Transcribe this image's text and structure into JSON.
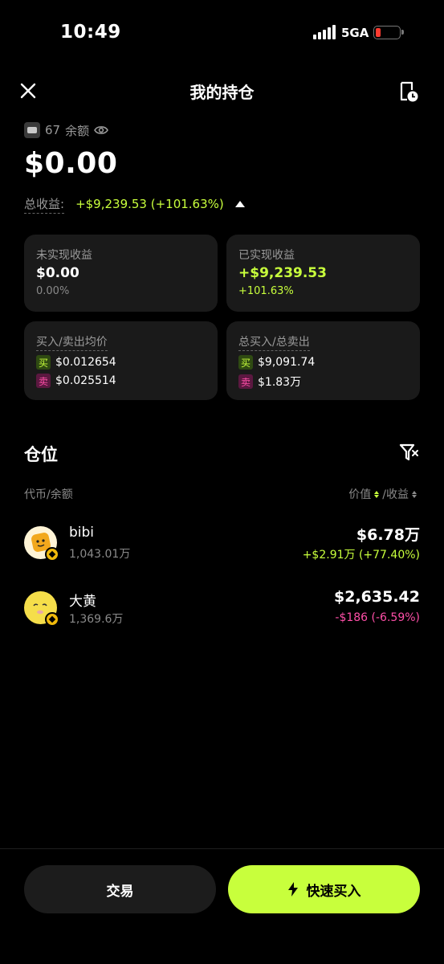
{
  "status": {
    "time": "10:49",
    "network": "5GA",
    "battery_level": 0.2,
    "battery_color": "#ff3b30"
  },
  "header": {
    "title": "我的持仓"
  },
  "balance": {
    "account_count": "67",
    "label": "余额",
    "value": "$0.00",
    "total_pnl_label": "总收益:",
    "total_pnl_value": "+$9,239.53 (+101.63%)"
  },
  "cards": {
    "unrealized": {
      "label": "未实现收益",
      "value": "$0.00",
      "percent": "0.00%"
    },
    "realized": {
      "label": "已实现收益",
      "value": "+$9,239.53",
      "percent": "+101.63%"
    },
    "avg_price": {
      "label": "买入/卖出均价",
      "buy_tag": "买",
      "buy_value": "$0.012654",
      "sell_tag": "卖",
      "sell_value": "$0.025514"
    },
    "totals": {
      "label": "总买入/总卖出",
      "buy_tag": "买",
      "buy_value": "$9,091.74",
      "sell_tag": "卖",
      "sell_value": "$1.83万"
    }
  },
  "positions": {
    "title": "仓位",
    "col_left": "代币/余额",
    "col_value": "价值",
    "col_pnl": "/收益",
    "items": [
      {
        "name": "bibi",
        "amount": "1,043.01万",
        "value": "$6.78万",
        "pnl": "+$2.91万 (+77.40%)",
        "pnl_color": "#c8ff3c",
        "avatar_color": "#fff4d6"
      },
      {
        "name": "大黄",
        "amount": "1,369.6万",
        "value": "$2,635.42",
        "pnl": "-$186 (-6.59%)",
        "pnl_color": "#ff4fa8",
        "avatar_color": "#f5de4a"
      }
    ]
  },
  "footer": {
    "trade_label": "交易",
    "quick_buy_label": "快速买入",
    "accent": "#c8ff3c"
  }
}
